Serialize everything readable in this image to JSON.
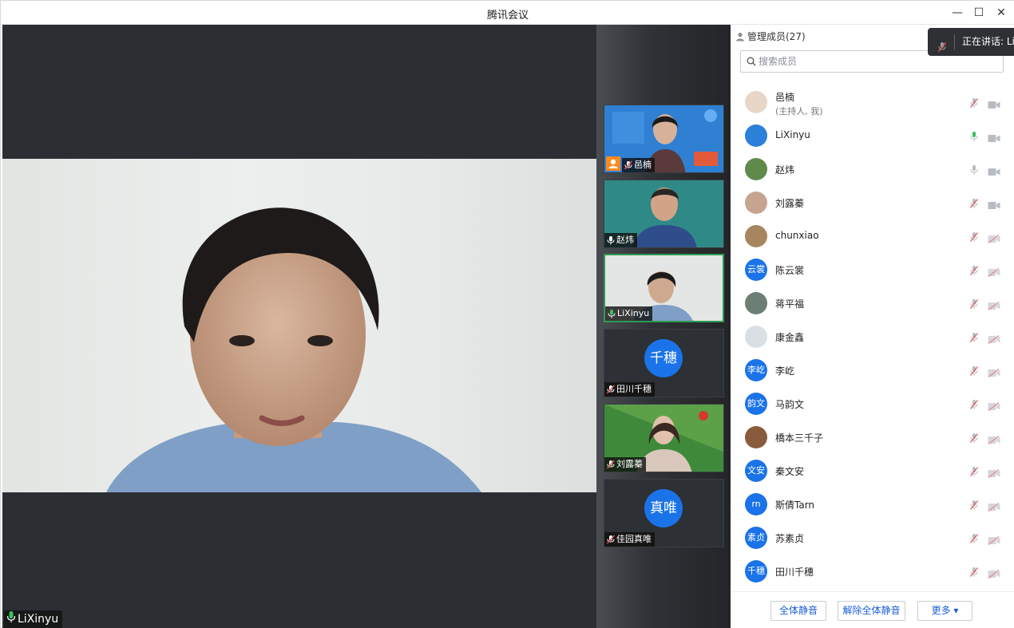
{
  "window": {
    "title": "腾讯会议",
    "min": "—",
    "max": "☐",
    "close": "✕"
  },
  "stage": {
    "speaker_name": "LiXinyu"
  },
  "strip": {
    "tiles": [
      {
        "name": "邑楠",
        "type": "video",
        "host": true
      },
      {
        "name": "赵炜",
        "type": "video"
      },
      {
        "name": "LiXinyu",
        "type": "video",
        "active": true
      },
      {
        "name": "田川千穗",
        "type": "avatar",
        "avatar_text": "千穗"
      },
      {
        "name": "刘露蓁",
        "type": "video"
      },
      {
        "name": "佳园真唯",
        "type": "avatar",
        "avatar_text": "真唯"
      }
    ]
  },
  "panel": {
    "header": "管理成员(27)",
    "speaking": "正在讲话: LiX",
    "search_placeholder": "搜索成员",
    "members": [
      {
        "name": "邑楠",
        "sub": "(主持人, 我)",
        "mic": "muted",
        "cam": "on",
        "avatar_color": "#e8d7c8"
      },
      {
        "name": "LiXinyu",
        "mic": "active",
        "cam": "on",
        "avatar_color": "#2b80d9"
      },
      {
        "name": "赵炜",
        "mic": "on",
        "cam": "on",
        "avatar_color": "#5f8a4c"
      },
      {
        "name": "刘露蓁",
        "mic": "muted",
        "cam": "on",
        "avatar_color": "#c6a48f"
      },
      {
        "name": "chunxiao",
        "mic": "muted",
        "cam": "off",
        "avatar_color": "#a7865f"
      },
      {
        "name": "陈云裳",
        "mic": "muted",
        "cam": "off",
        "avatar_text": "云裳"
      },
      {
        "name": "蒋平福",
        "mic": "muted",
        "cam": "off",
        "avatar_color": "#6d7f74"
      },
      {
        "name": "康金鑫",
        "mic": "muted",
        "cam": "off",
        "avatar_color": "#d9dfe4"
      },
      {
        "name": "李屹",
        "mic": "muted",
        "cam": "off",
        "avatar_text": "李屹"
      },
      {
        "name": "马韵文",
        "mic": "muted",
        "cam": "off",
        "avatar_text": "韵文"
      },
      {
        "name": "橋本三千子",
        "mic": "muted",
        "cam": "off",
        "avatar_color": "#8a5a3c"
      },
      {
        "name": "秦文安",
        "mic": "muted",
        "cam": "off",
        "avatar_text": "文安"
      },
      {
        "name": "斯倩Tarn",
        "mic": "muted",
        "cam": "off",
        "avatar_text": "rn"
      },
      {
        "name": "苏素贞",
        "mic": "muted",
        "cam": "off",
        "avatar_text": "素贞"
      },
      {
        "name": "田川千穗",
        "mic": "muted",
        "cam": "off",
        "avatar_text": "千穗"
      }
    ],
    "footer": {
      "mute_all": "全体静音",
      "unmute_all": "解除全体静音",
      "more": "更多 ▾"
    }
  },
  "colors": {
    "accent": "#1a73e8",
    "active_green": "#2e9a52",
    "muted_red": "#e05a5a"
  }
}
